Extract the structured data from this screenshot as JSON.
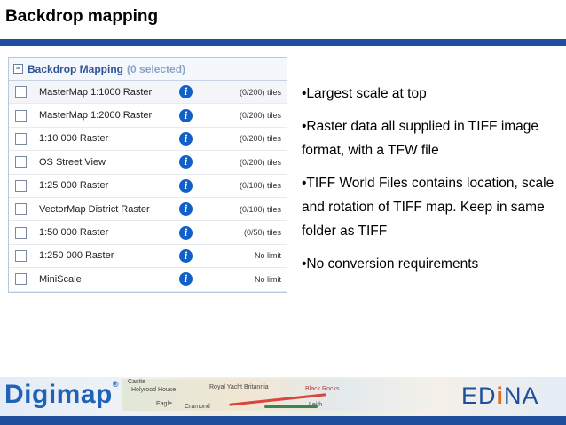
{
  "slide": {
    "title": "Backdrop mapping"
  },
  "panel": {
    "header": "Backdrop Mapping",
    "selected": "(0 selected)",
    "layers": [
      {
        "name": "MasterMap 1:1000 Raster",
        "tiles": "(0/200) tiles"
      },
      {
        "name": "MasterMap 1:2000 Raster",
        "tiles": "(0/200) tiles"
      },
      {
        "name": "1:10 000 Raster",
        "tiles": "(0/200) tiles"
      },
      {
        "name": "OS Street View",
        "tiles": "(0/200) tiles"
      },
      {
        "name": "1:25 000 Raster",
        "tiles": "(0/100) tiles"
      },
      {
        "name": "VectorMap District Raster",
        "tiles": "(0/100) tiles"
      },
      {
        "name": "1:50 000 Raster",
        "tiles": "(0/50) tiles"
      },
      {
        "name": "1:250 000 Raster",
        "tiles": "No limit"
      },
      {
        "name": "MiniScale",
        "tiles": "No limit"
      }
    ],
    "info_glyph": "i"
  },
  "bullets": [
    "•Largest scale at top",
    "•Raster data all supplied in TIFF image format, with a TFW file",
    "•TIFF World Files contains location, scale and rotation of TIFF map. Keep in same folder as TIFF",
    "•No conversion requirements"
  ],
  "footer": {
    "brand": "Digimap",
    "registered": "®",
    "partner_pre": "ED",
    "partner_i": "i",
    "partner_post": "NA",
    "map_labels": [
      "Castle",
      "Holyrood House",
      "Royal Yacht Britannia",
      "Black Rocks",
      "Eagle",
      "Cramond",
      "Leith"
    ]
  },
  "colors": {
    "brand_blue": "#1f4e9c",
    "info_blue": "#1060c8",
    "edina_orange": "#e36b1c"
  }
}
